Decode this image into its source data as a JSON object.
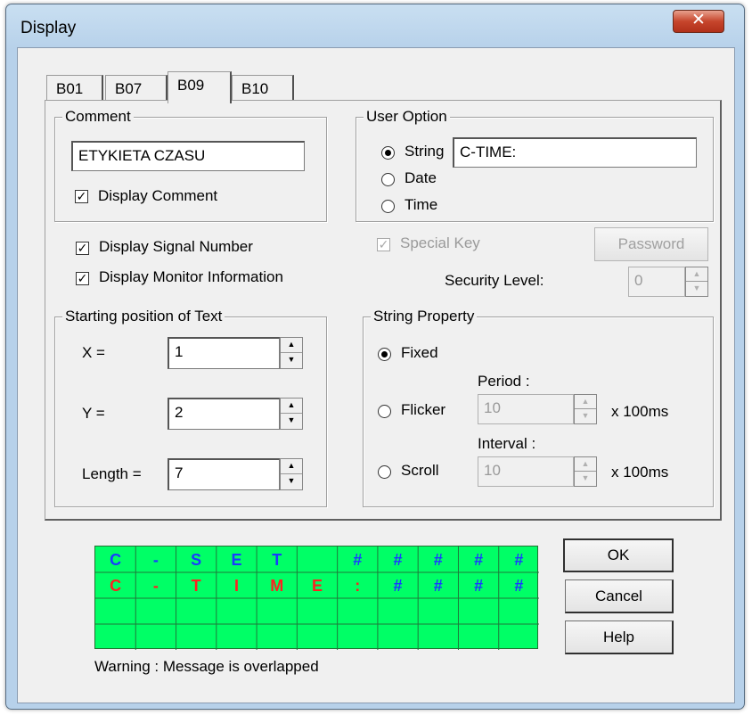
{
  "window": {
    "title": "Display",
    "close_glyph": "✕"
  },
  "tabs": [
    {
      "label": "B01"
    },
    {
      "label": "B07"
    },
    {
      "label": "B09",
      "active": true
    },
    {
      "label": "B10"
    }
  ],
  "comment": {
    "group_title": "Comment",
    "value": "ETYKIETA CZASU",
    "display_comment_label": "Display Comment",
    "display_comment_checked": true
  },
  "user_option": {
    "group_title": "User Option",
    "string_label": "String",
    "date_label": "Date",
    "time_label": "Time",
    "selected": "String",
    "string_value": "C-TIME:"
  },
  "options": {
    "display_signal_number_label": "Display Signal Number",
    "display_signal_number_checked": true,
    "display_monitor_info_label": "Display Monitor Information",
    "display_monitor_info_checked": true,
    "special_key_label": "Special Key",
    "special_key_checked": true,
    "password_label": "Password",
    "security_level_label": "Security Level:",
    "security_level_value": "0"
  },
  "starting_position": {
    "group_title": "Starting position of Text",
    "x_label": "X =",
    "x_value": "1",
    "y_label": "Y =",
    "y_value": "2",
    "length_label": "Length =",
    "length_value": "7"
  },
  "string_property": {
    "group_title": "String Property",
    "fixed_label": "Fixed",
    "flicker_label": "Flicker",
    "scroll_label": "Scroll",
    "selected": "Fixed",
    "period_label": "Period :",
    "period_value": "10",
    "interval_label": "Interval :",
    "interval_value": "10",
    "unit_label": "x 100ms"
  },
  "lcd_preview": {
    "bg_color": "#00ff66",
    "rows": [
      {
        "color": "#1a3bff",
        "cells": [
          "C",
          "-",
          "S",
          "E",
          "T",
          "",
          "#",
          "#",
          "#",
          "#",
          "#"
        ]
      },
      {
        "color": "#ff2020",
        "hash_color": "#1a3bff",
        "cells": [
          "C",
          "-",
          "T",
          "I",
          "M",
          "E",
          ":",
          "#",
          "#",
          "#",
          "#"
        ]
      }
    ]
  },
  "warning": "Warning : Message is overlapped",
  "buttons": {
    "ok": "OK",
    "cancel": "Cancel",
    "help": "Help"
  }
}
